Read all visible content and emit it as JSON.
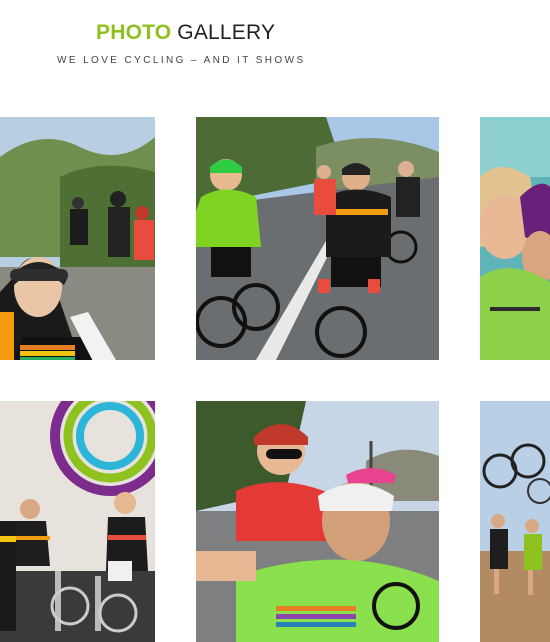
{
  "header": {
    "title_accent": "PHOTO",
    "title_rest": "GALLERY",
    "subtitle": "WE LOVE CYCLING – AND IT SHOWS"
  },
  "colors": {
    "accent": "#8dc21f",
    "title": "#222222",
    "subtitle": "#444444",
    "background": "#ffffff"
  },
  "gallery": {
    "photos": [
      {
        "name": "photo-1",
        "subject": "cyclists-group-outdoors"
      },
      {
        "name": "photo-2",
        "subject": "cyclists-riding-road"
      },
      {
        "name": "photo-3",
        "subject": "cyclists-closeup"
      },
      {
        "name": "photo-4",
        "subject": "indoor-spin-class"
      },
      {
        "name": "photo-5",
        "subject": "cyclists-selfie"
      },
      {
        "name": "photo-6",
        "subject": "cyclists-bikes-raised"
      }
    ]
  }
}
